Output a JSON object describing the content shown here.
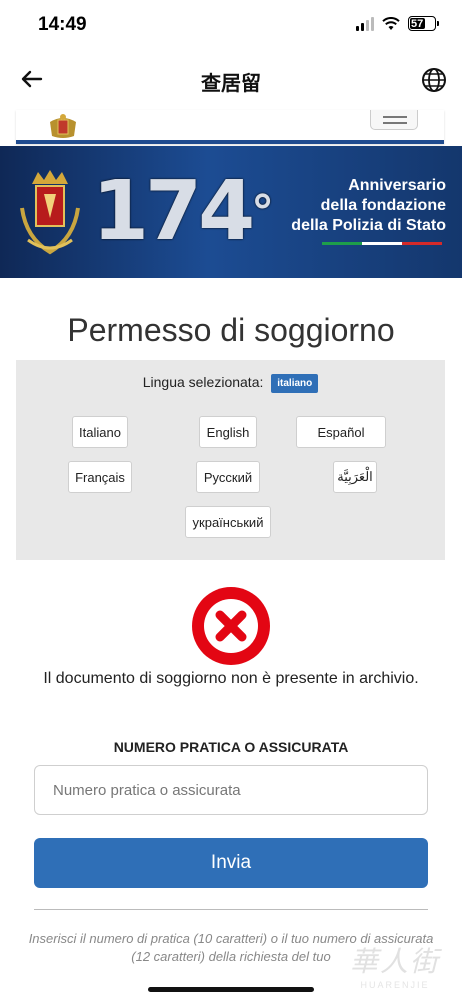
{
  "status_bar": {
    "time": "14:49",
    "battery": "57"
  },
  "nav": {
    "title": "查居留"
  },
  "banner": {
    "number": "174",
    "degree": "°",
    "lines": [
      "Anniversario",
      "della fondazione",
      "della Polizia di Stato"
    ],
    "flag_colors": [
      "#1e9e4a",
      "#ffffff",
      "#d42a2a"
    ]
  },
  "page_title": "Permesso di soggiorno",
  "language": {
    "selected_label": "Lingua selezionata:",
    "selected_value": "italiano",
    "options": [
      "Italiano",
      "English",
      "Español",
      "Français",
      "Русский",
      "الْعَرَبِيَّة",
      "український"
    ]
  },
  "result": {
    "message": "Il documento di soggiorno non è presente in archivio."
  },
  "form": {
    "label": "NUMERO PRATICA O ASSICURATA",
    "placeholder": "Numero pratica o assicurata",
    "submit_label": "Invia",
    "help_text": "Inserisci il numero di pratica (10 caratteri) o il tuo numero di assicurata (12 caratteri) della richiesta del tuo"
  },
  "watermark": {
    "main": "華人街",
    "sub": "HUARENJIE"
  },
  "colors": {
    "accent": "#2f6fb7",
    "error": "#e30613",
    "header_border": "#1f4b8f"
  }
}
